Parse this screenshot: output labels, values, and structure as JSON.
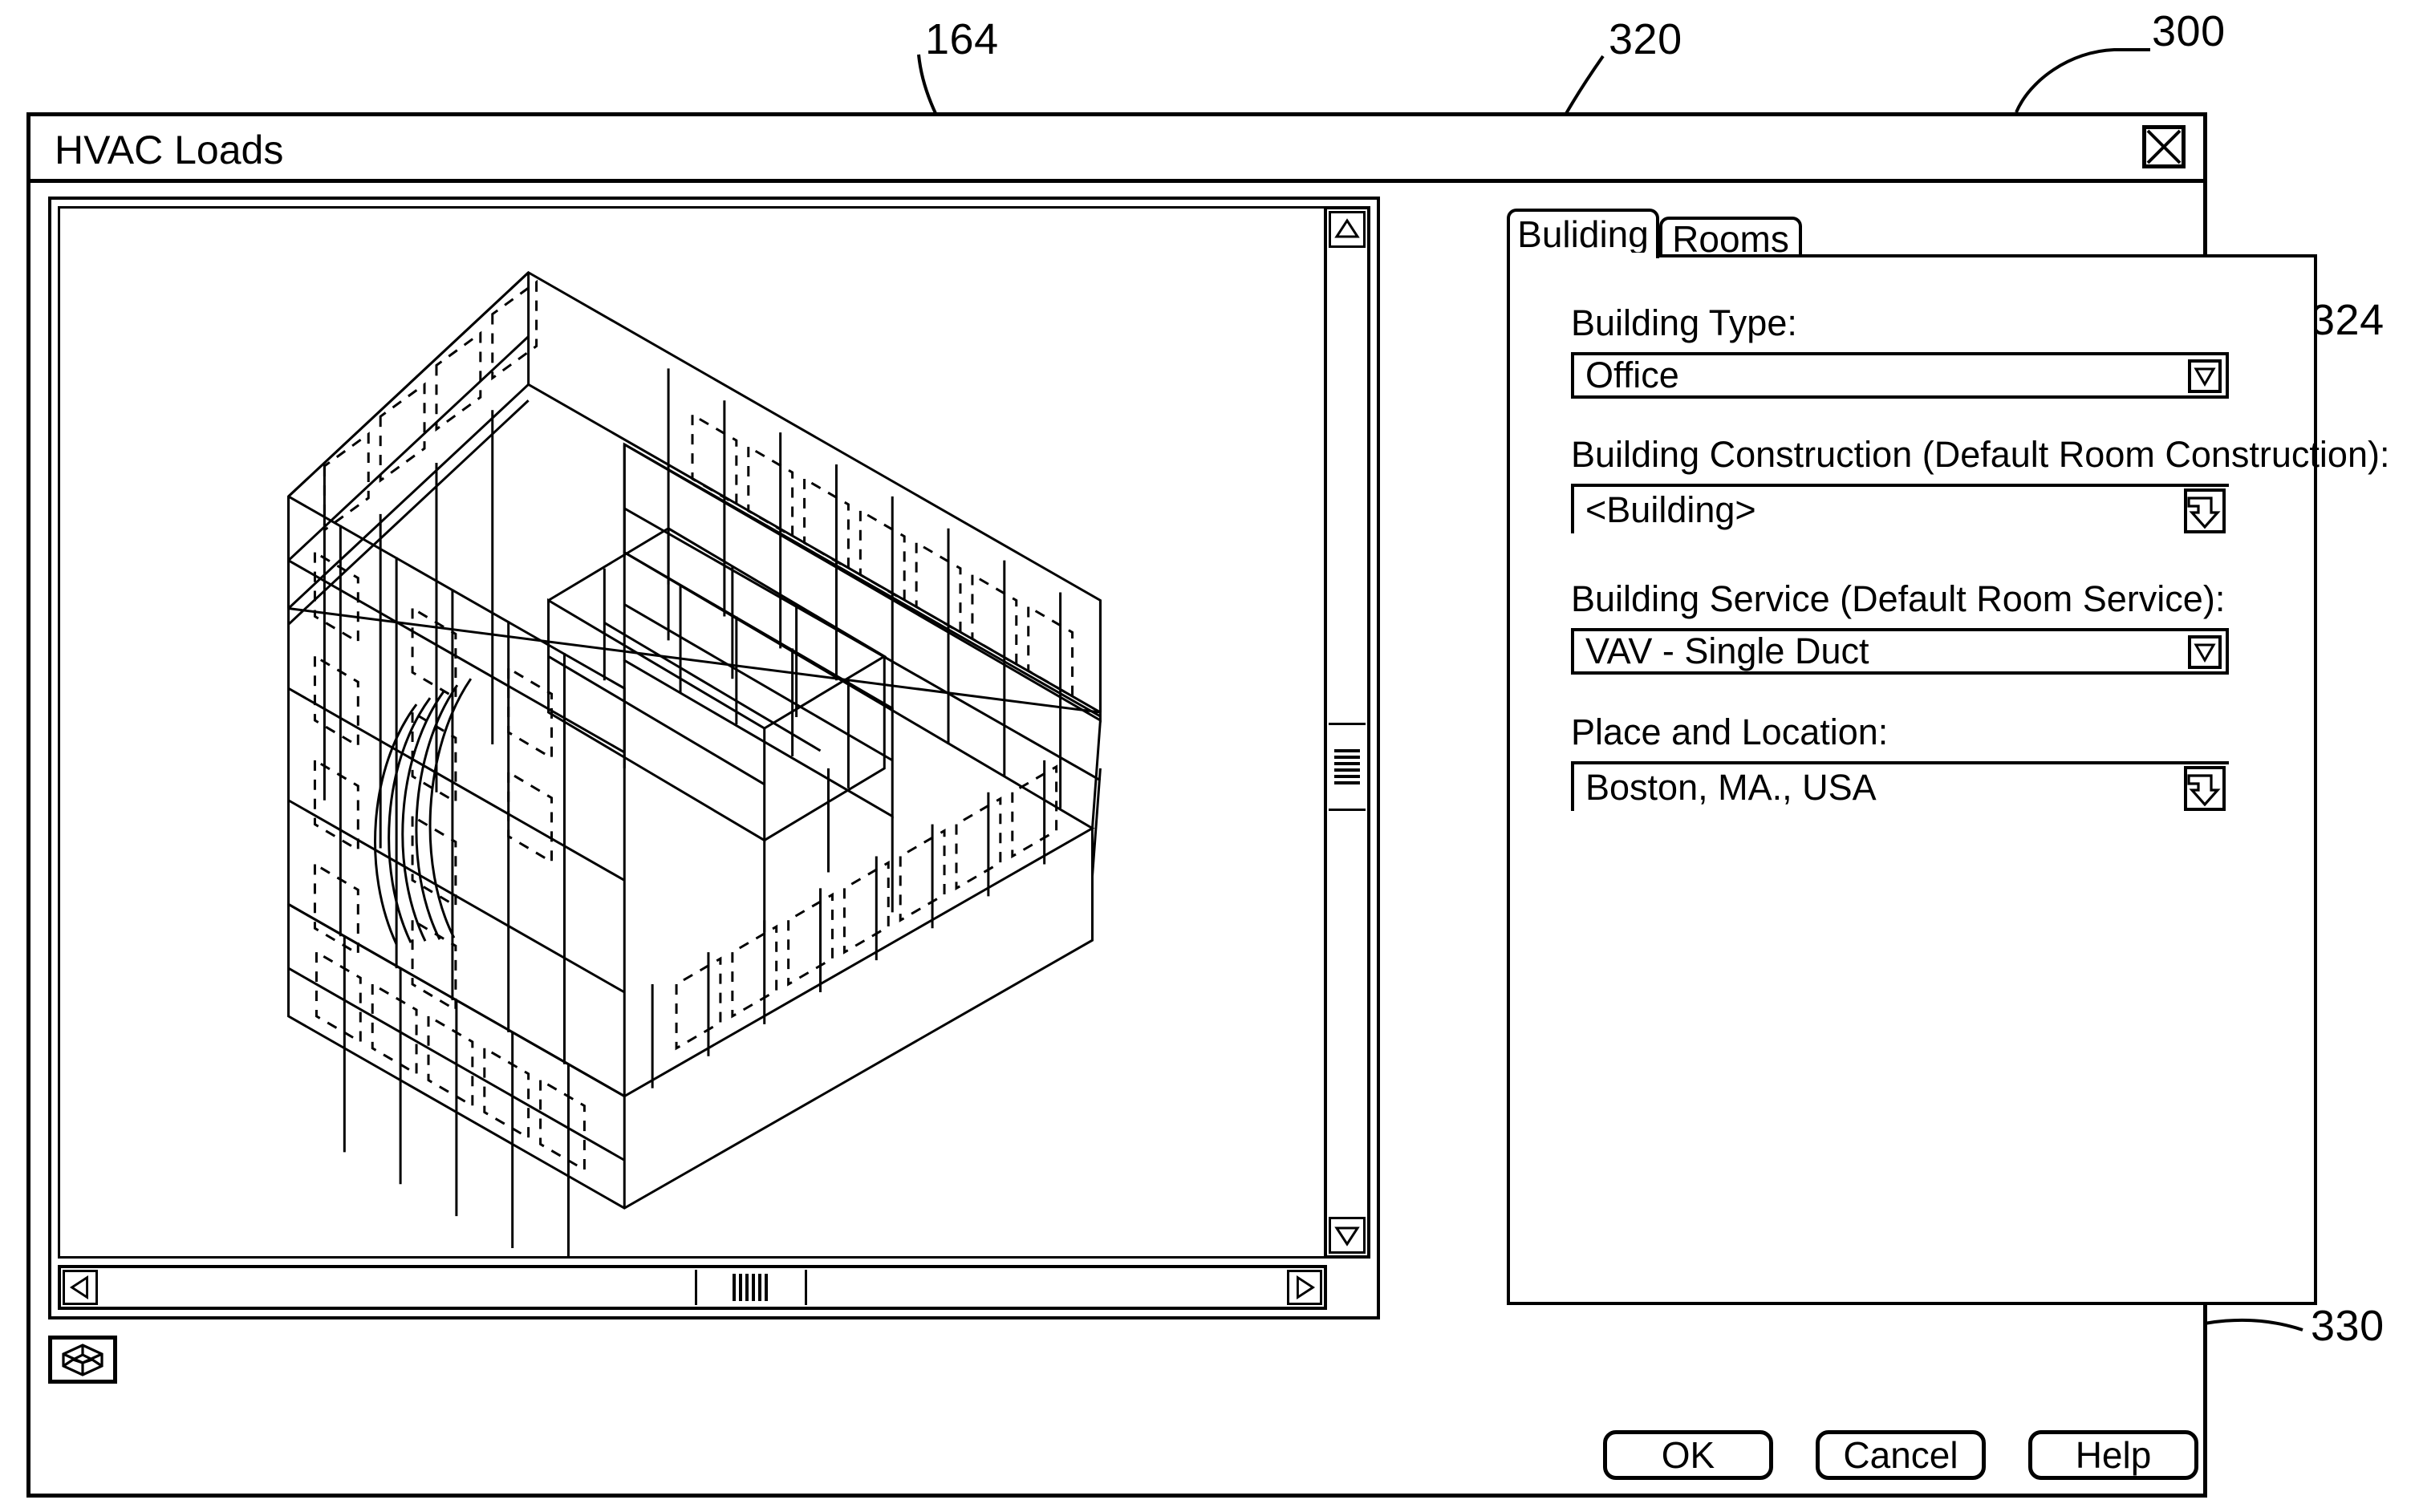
{
  "window": {
    "title": "HVAC Loads",
    "close_icon": "close-x-icon"
  },
  "reference_numerals": [
    {
      "label": "164",
      "target": "3d-model-viewport"
    },
    {
      "label": "320",
      "target": "tab-strip"
    },
    {
      "label": "300",
      "target": "dialog-window"
    },
    {
      "label": "324",
      "target": "building-type-dropdown-arrow"
    },
    {
      "label": "330",
      "target": "tab-panel"
    }
  ],
  "viewport": {
    "name": "3d-building-model",
    "iso_button_icon": "wireframe-cube-icon",
    "vscroll": {
      "up_icon": "triangle-up-icon",
      "down_icon": "triangle-down-icon",
      "thumb_position_percent": 52
    },
    "hscroll": {
      "left_icon": "triangle-left-icon",
      "right_icon": "triangle-right-icon",
      "thumb_position_percent": 52
    }
  },
  "tabs": [
    {
      "label": "Buliding",
      "active": true
    },
    {
      "label": "Rooms",
      "active": false
    }
  ],
  "form": {
    "building_type": {
      "label": "Building Type:",
      "value": "Office",
      "control": "dropdown",
      "icon": "chevron-down-icon"
    },
    "building_construction": {
      "label": "Building Construction (Default Room Construction):",
      "value": "<Building>",
      "control": "browse",
      "icon": "goto-arrow-icon"
    },
    "building_service": {
      "label": "Building Service (Default Room Service):",
      "value": "VAV - Single Duct",
      "control": "dropdown",
      "icon": "chevron-down-icon"
    },
    "place_and_location": {
      "label": "Place and Location:",
      "value": "Boston, MA., USA",
      "control": "browse",
      "icon": "goto-arrow-icon"
    }
  },
  "footer": {
    "ok_label": "OK",
    "cancel_label": "Cancel",
    "help_label": "Help"
  }
}
